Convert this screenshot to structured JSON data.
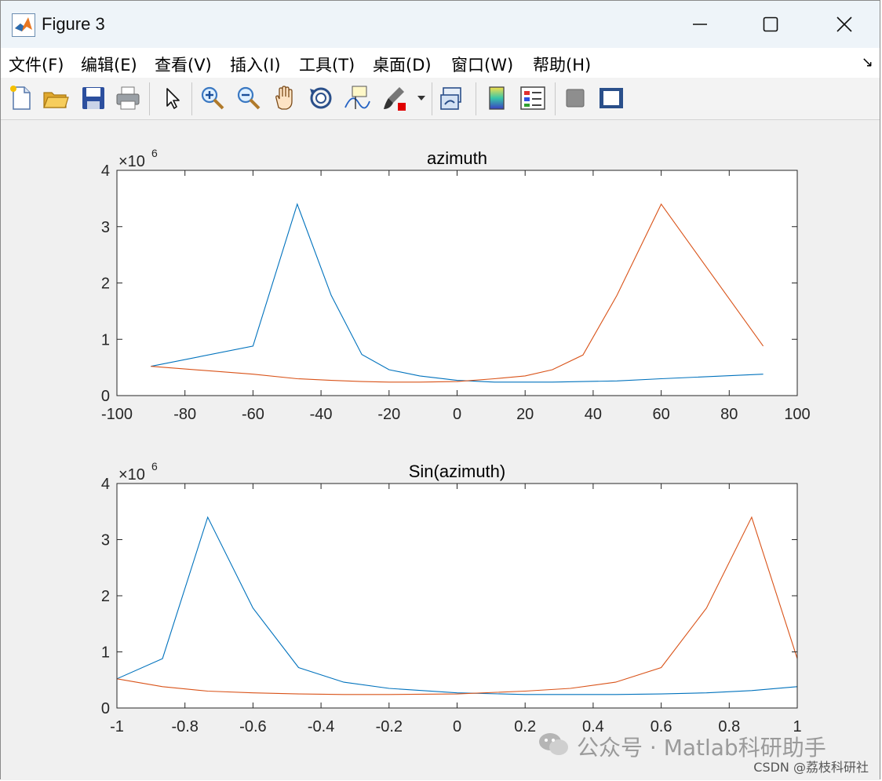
{
  "window": {
    "title": "Figure 3",
    "controls": [
      "minimize",
      "maximize",
      "close"
    ]
  },
  "menubar": {
    "items": [
      {
        "label": "文件(F)"
      },
      {
        "label": "编辑(E)"
      },
      {
        "label": "查看(V)"
      },
      {
        "label": "插入(I)"
      },
      {
        "label": "工具(T)"
      },
      {
        "label": "桌面(D)"
      },
      {
        "label": "窗口(W)"
      },
      {
        "label": "帮助(H)"
      }
    ]
  },
  "toolbar": {
    "buttons": [
      {
        "icon": "new-figure-icon"
      },
      {
        "icon": "open-folder-icon"
      },
      {
        "icon": "save-icon"
      },
      {
        "icon": "print-icon"
      },
      {
        "icon": "pointer-icon"
      },
      {
        "icon": "zoom-in-icon"
      },
      {
        "icon": "zoom-out-icon"
      },
      {
        "icon": "pan-hand-icon"
      },
      {
        "icon": "rotate-3d-icon"
      },
      {
        "icon": "data-cursor-icon"
      },
      {
        "icon": "brush-icon"
      },
      {
        "icon": "link-plot-icon"
      },
      {
        "icon": "colorbar-icon"
      },
      {
        "icon": "legend-icon"
      },
      {
        "icon": "hide-plot-tools-icon"
      },
      {
        "icon": "show-plot-tools-icon"
      }
    ]
  },
  "watermark": {
    "text": "公众号 · Matlab科研助手",
    "credit": "CSDN @荔枝科研社"
  },
  "colors": {
    "series1": "#0072BD",
    "series2": "#D95319"
  },
  "chart_data": [
    {
      "type": "line",
      "title": "azimuth",
      "exponent_label": "×10",
      "exponent_power": "6",
      "xlim": [
        -100,
        100
      ],
      "ylim": [
        0,
        4
      ],
      "x_ticks": [
        "-100",
        "-80",
        "-60",
        "-40",
        "-20",
        "0",
        "20",
        "40",
        "60",
        "80",
        "100"
      ],
      "y_ticks": [
        "0",
        "1",
        "2",
        "3",
        "4"
      ],
      "x": [
        -90,
        -60,
        -47,
        -37,
        -28,
        -20,
        -11,
        0,
        11,
        20,
        28,
        37,
        47,
        60,
        90
      ],
      "series": [
        {
          "values": [
            0.52,
            0.88,
            3.4,
            1.78,
            0.73,
            0.46,
            0.35,
            0.27,
            0.24,
            0.24,
            0.24,
            0.25,
            0.26,
            0.3,
            0.38
          ]
        },
        {
          "values": [
            0.52,
            0.38,
            0.3,
            0.27,
            0.25,
            0.24,
            0.24,
            0.25,
            0.3,
            0.35,
            0.46,
            0.72,
            1.78,
            3.4,
            0.88
          ]
        }
      ]
    },
    {
      "type": "line",
      "title": "Sin(azimuth)",
      "exponent_label": "×10",
      "exponent_power": "6",
      "xlim": [
        -1,
        1
      ],
      "ylim": [
        0,
        4
      ],
      "x_ticks": [
        "-1",
        "-0.8",
        "-0.6",
        "-0.4",
        "-0.2",
        "0",
        "0.2",
        "0.4",
        "0.6",
        "0.8",
        "1"
      ],
      "y_ticks": [
        "0",
        "1",
        "2",
        "3",
        "4"
      ],
      "x": [
        -1,
        -0.866,
        -0.733,
        -0.6,
        -0.466,
        -0.333,
        -0.2,
        0,
        0.2,
        0.333,
        0.466,
        0.6,
        0.733,
        0.866,
        1
      ],
      "series": [
        {
          "values": [
            0.52,
            0.88,
            3.4,
            1.78,
            0.72,
            0.46,
            0.35,
            0.27,
            0.24,
            0.24,
            0.24,
            0.25,
            0.27,
            0.31,
            0.38
          ]
        },
        {
          "values": [
            0.52,
            0.38,
            0.3,
            0.27,
            0.25,
            0.24,
            0.24,
            0.25,
            0.3,
            0.35,
            0.46,
            0.72,
            1.78,
            3.4,
            0.88
          ]
        }
      ]
    }
  ]
}
